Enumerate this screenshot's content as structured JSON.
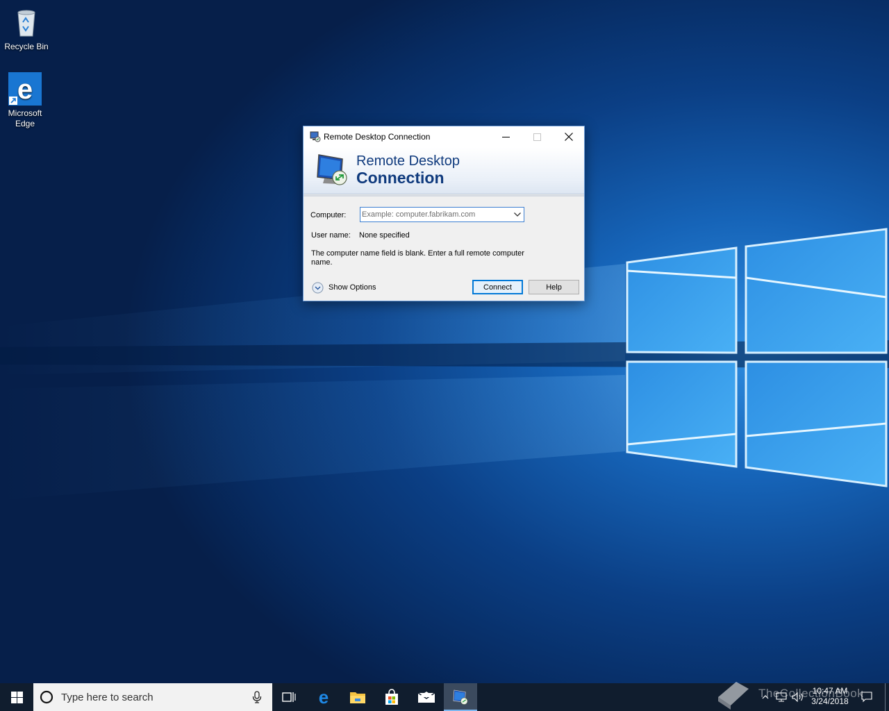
{
  "desktop": {
    "icons": [
      {
        "label": "Recycle Bin",
        "icon": "recycle-bin-icon"
      },
      {
        "label_line1": "Microsoft",
        "label_line2": "Edge",
        "icon": "edge-icon"
      }
    ]
  },
  "dialog": {
    "title": "Remote Desktop Connection",
    "banner_line1": "Remote Desktop",
    "banner_line2": "Connection",
    "computer_label": "Computer:",
    "computer_value": "",
    "computer_placeholder": "Example: computer.fabrikam.com",
    "username_label": "User name:",
    "username_value": "None specified",
    "message": "The computer name field is blank. Enter a full remote computer name.",
    "show_options": "Show Options",
    "connect_label": "Connect",
    "help_label": "Help",
    "colors": {
      "accent": "#0078d7",
      "banner_text": "#0f3a7d"
    }
  },
  "taskbar": {
    "search_placeholder": "Type here to search",
    "apps": [
      "task-view-icon",
      "edge-icon",
      "file-explorer-icon",
      "store-icon",
      "mail-icon",
      "remote-desktop-icon"
    ],
    "active_app": "remote-desktop-icon",
    "clock_time": "10:47 AM",
    "clock_date": "3/24/2018",
    "watermark": "TheCollectionBook"
  }
}
